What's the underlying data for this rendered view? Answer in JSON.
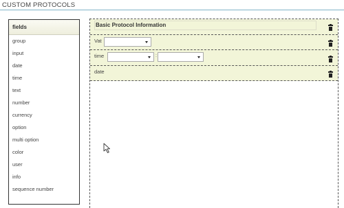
{
  "page": {
    "title": "CUSTOM PROTOCOLS"
  },
  "fields_panel": {
    "header": "fields",
    "items": [
      "group",
      "input",
      "date",
      "time",
      "text",
      "number",
      "currency",
      "option",
      "multi option",
      "color",
      "user",
      "info",
      "sequence number"
    ]
  },
  "form": {
    "section_title": "Basic Protocol Information",
    "rows": [
      {
        "label": "Vat",
        "selects": [
          ""
        ]
      },
      {
        "label": "time",
        "selects": [
          "",
          ""
        ]
      },
      {
        "label": "date"
      }
    ]
  },
  "icons": {
    "delete": "trash-icon",
    "cursor": "mouse-pointer-icon"
  }
}
